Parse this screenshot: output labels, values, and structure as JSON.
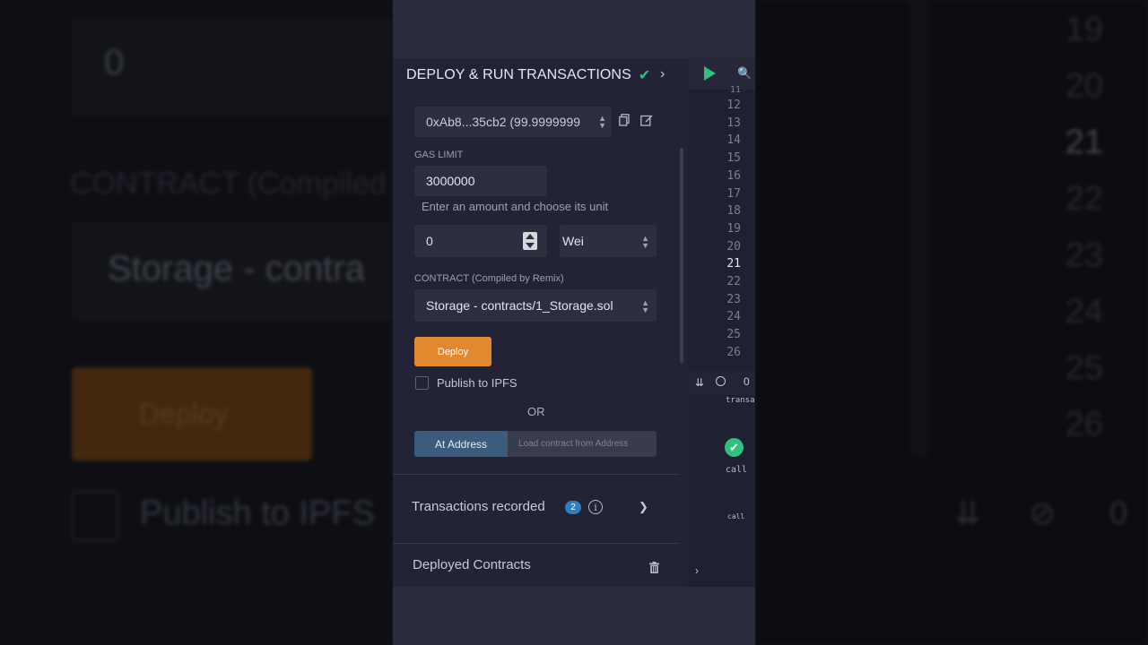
{
  "background": {
    "left": {
      "value": "0",
      "contract_label": "CONTRACT (Compiled",
      "contract_value": "Storage - contra",
      "deploy_label": "Deploy",
      "ipfs_label": "Publish to IPFS"
    },
    "right": {
      "lines": [
        "19",
        "20",
        "21",
        "22",
        "23",
        "24",
        "25",
        "26"
      ],
      "active_line": "21",
      "counter": "0"
    }
  },
  "panel": {
    "title": "DEPLOY & RUN TRANSACTIONS",
    "account": "0xAb8...35cb2 (99.9999999",
    "gas_limit_label": "GAS LIMIT",
    "gas_limit": "3000000",
    "value_hint": "Enter an amount and choose its unit",
    "value": "0",
    "unit": "Wei",
    "contract_label": "CONTRACT (Compiled by Remix)",
    "contract": "Storage - contracts/1_Storage.sol",
    "deploy_label": "Deploy",
    "ipfs_label": "Publish to IPFS",
    "or_label": "OR",
    "at_address_label": "At Address",
    "address_placeholder": "Load contract from Address",
    "transactions_label": "Transactions recorded",
    "transactions_count": "2",
    "deployed_label": "Deployed Contracts"
  },
  "editor": {
    "first_partial": "11",
    "lines": [
      "12",
      "13",
      "14",
      "15",
      "16",
      "17",
      "18",
      "19",
      "20",
      "21",
      "22",
      "23",
      "24",
      "25",
      "26"
    ],
    "active_line": "21",
    "terminal_count": "0",
    "terminal_lines": [
      "transa",
      "call",
      "call"
    ]
  },
  "colors": {
    "accent_green": "#2ec27e",
    "deploy_orange": "#e2892f",
    "at_address_blue": "#3b5c7c",
    "badge_blue": "#2d7fc4"
  },
  "icons": [
    "check-icon",
    "chevron-right-icon",
    "play-icon",
    "search-icon",
    "copy-icon",
    "edit-icon",
    "info-icon",
    "trash-icon",
    "double-chevron-down-icon",
    "block-icon"
  ]
}
